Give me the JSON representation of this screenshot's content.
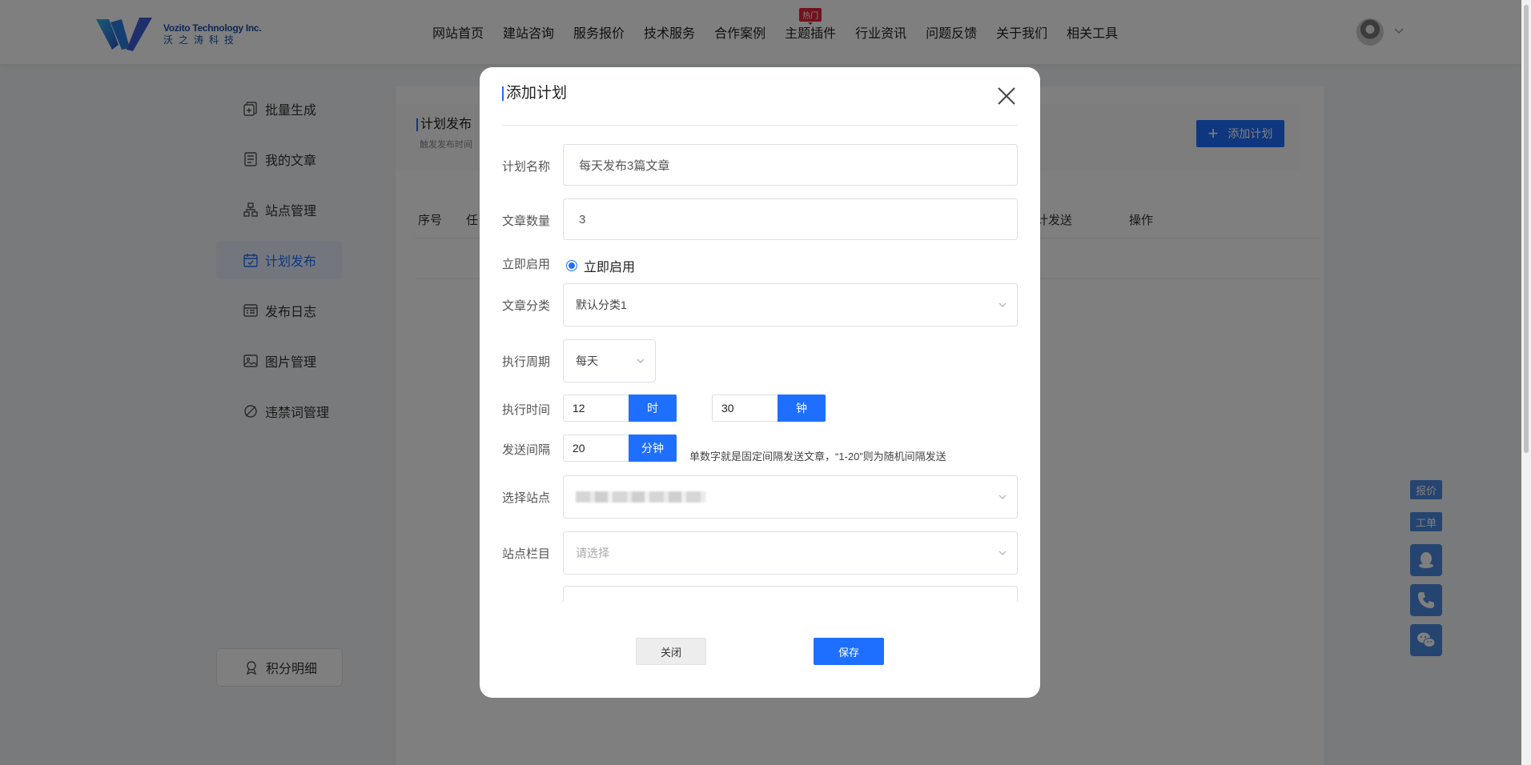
{
  "header": {
    "logo_en": "Vozito Technology Inc.",
    "logo_cn": "沃之涛科技",
    "nav": [
      {
        "label": "网站首页"
      },
      {
        "label": "建站咨询"
      },
      {
        "label": "服务报价"
      },
      {
        "label": "技术服务"
      },
      {
        "label": "合作案例"
      },
      {
        "label": "主题插件",
        "badge": "热门"
      },
      {
        "label": "行业资讯"
      },
      {
        "label": "问题反馈"
      },
      {
        "label": "关于我们"
      },
      {
        "label": "相关工具"
      }
    ]
  },
  "sidebar": {
    "items": [
      {
        "label": "批量生成",
        "icon": "batch-icon"
      },
      {
        "label": "我的文章",
        "icon": "article-icon"
      },
      {
        "label": "站点管理",
        "icon": "sitemap-icon"
      },
      {
        "label": "计划发布",
        "icon": "calendar-icon",
        "active": true
      },
      {
        "label": "发布日志",
        "icon": "log-icon"
      },
      {
        "label": "图片管理",
        "icon": "image-icon"
      },
      {
        "label": "违禁词管理",
        "icon": "forbidden-icon"
      }
    ],
    "points_label": "积分明细"
  },
  "main": {
    "title": "计划发布",
    "desc": "触发发布时间",
    "add_button": "添加计划",
    "columns": [
      "序号",
      "任",
      "计发送",
      "操作"
    ]
  },
  "float_tools": {
    "quote": "报价",
    "ticket": "工单"
  },
  "modal": {
    "title": "添加计划",
    "fields": {
      "name_label": "计划名称",
      "name_value": "每天发布3篇文章",
      "count_label": "文章数量",
      "count_value": "3",
      "enable_label": "立即启用",
      "enable_option": "立即启用",
      "category_label": "文章分类",
      "category_value": "默认分类1",
      "cycle_label": "执行周期",
      "cycle_value": "每天",
      "time_label": "执行时间",
      "hour_value": "12",
      "hour_unit": "时",
      "minute_value": "30",
      "minute_unit": "钟",
      "interval_label": "发送间隔",
      "interval_value": "20",
      "interval_unit": "分钟",
      "interval_hint": "单数字就是固定间隔发送文章，“1-20”则为随机间隔发送",
      "site_label": "选择站点",
      "column_label": "站点栏目",
      "column_placeholder": "请选择"
    },
    "close_button": "关闭",
    "save_button": "保存"
  },
  "colors": {
    "primary": "#1e6fff",
    "badge": "#e0263c",
    "float_tool": "#4a8be0"
  }
}
